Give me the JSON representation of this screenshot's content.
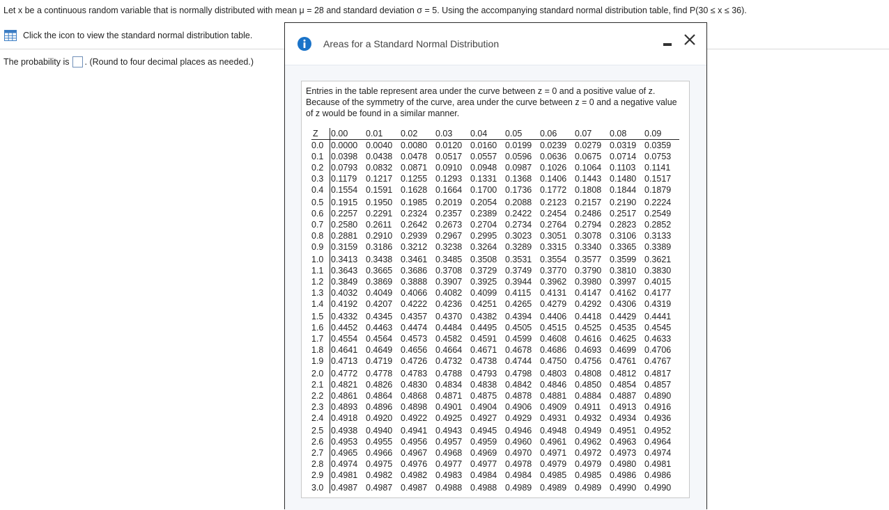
{
  "question": {
    "text": "Let x be a continuous random variable that is normally distributed with mean μ = 28 and standard deviation σ = 5. Using the accompanying standard normal distribution table, find P(30 ≤ x ≤ 36)."
  },
  "hint": {
    "icon": "table-icon",
    "text": "Click the icon to view the standard normal distribution table."
  },
  "answer": {
    "prefix": "The probability is",
    "value": "",
    "suffix": ". (Round to four decimal places as needed.)"
  },
  "dialog": {
    "title": "Areas for a Standard Normal Distribution",
    "description": "Entries in the table represent area under the curve between z = 0 and a positive value of z. Because of the symmetry of the curve, area under the curve between z = 0 and a negative value of z would be found in a similar manner.",
    "accent_color": "#1a73c8"
  },
  "table": {
    "z_header": "Z",
    "columns": [
      "0.00",
      "0.01",
      "0.02",
      "0.03",
      "0.04",
      "0.05",
      "0.06",
      "0.07",
      "0.08",
      "0.09"
    ],
    "rows": [
      {
        "z": "0.0",
        "v": [
          "0.0000",
          "0.0040",
          "0.0080",
          "0.0120",
          "0.0160",
          "0.0199",
          "0.0239",
          "0.0279",
          "0.0319",
          "0.0359"
        ]
      },
      {
        "z": "0.1",
        "v": [
          "0.0398",
          "0.0438",
          "0.0478",
          "0.0517",
          "0.0557",
          "0.0596",
          "0.0636",
          "0.0675",
          "0.0714",
          "0.0753"
        ]
      },
      {
        "z": "0.2",
        "v": [
          "0.0793",
          "0.0832",
          "0.0871",
          "0.0910",
          "0.0948",
          "0.0987",
          "0.1026",
          "0.1064",
          "0.1103",
          "0.1141"
        ]
      },
      {
        "z": "0.3",
        "v": [
          "0.1179",
          "0.1217",
          "0.1255",
          "0.1293",
          "0.1331",
          "0.1368",
          "0.1406",
          "0.1443",
          "0.1480",
          "0.1517"
        ]
      },
      {
        "z": "0.4",
        "v": [
          "0.1554",
          "0.1591",
          "0.1628",
          "0.1664",
          "0.1700",
          "0.1736",
          "0.1772",
          "0.1808",
          "0.1844",
          "0.1879"
        ]
      },
      {
        "z": "0.5",
        "v": [
          "0.1915",
          "0.1950",
          "0.1985",
          "0.2019",
          "0.2054",
          "0.2088",
          "0.2123",
          "0.2157",
          "0.2190",
          "0.2224"
        ]
      },
      {
        "z": "0.6",
        "v": [
          "0.2257",
          "0.2291",
          "0.2324",
          "0.2357",
          "0.2389",
          "0.2422",
          "0.2454",
          "0.2486",
          "0.2517",
          "0.2549"
        ]
      },
      {
        "z": "0.7",
        "v": [
          "0.2580",
          "0.2611",
          "0.2642",
          "0.2673",
          "0.2704",
          "0.2734",
          "0.2764",
          "0.2794",
          "0.2823",
          "0.2852"
        ]
      },
      {
        "z": "0.8",
        "v": [
          "0.2881",
          "0.2910",
          "0.2939",
          "0.2967",
          "0.2995",
          "0.3023",
          "0.3051",
          "0.3078",
          "0.3106",
          "0.3133"
        ]
      },
      {
        "z": "0.9",
        "v": [
          "0.3159",
          "0.3186",
          "0.3212",
          "0.3238",
          "0.3264",
          "0.3289",
          "0.3315",
          "0.3340",
          "0.3365",
          "0.3389"
        ]
      },
      {
        "z": "1.0",
        "v": [
          "0.3413",
          "0.3438",
          "0.3461",
          "0.3485",
          "0.3508",
          "0.3531",
          "0.3554",
          "0.3577",
          "0.3599",
          "0.3621"
        ]
      },
      {
        "z": "1.1",
        "v": [
          "0.3643",
          "0.3665",
          "0.3686",
          "0.3708",
          "0.3729",
          "0.3749",
          "0.3770",
          "0.3790",
          "0.3810",
          "0.3830"
        ]
      },
      {
        "z": "1.2",
        "v": [
          "0.3849",
          "0.3869",
          "0.3888",
          "0.3907",
          "0.3925",
          "0.3944",
          "0.3962",
          "0.3980",
          "0.3997",
          "0.4015"
        ]
      },
      {
        "z": "1.3",
        "v": [
          "0.4032",
          "0.4049",
          "0.4066",
          "0.4082",
          "0.4099",
          "0.4115",
          "0.4131",
          "0.4147",
          "0.4162",
          "0.4177"
        ]
      },
      {
        "z": "1.4",
        "v": [
          "0.4192",
          "0.4207",
          "0.4222",
          "0.4236",
          "0.4251",
          "0.4265",
          "0.4279",
          "0.4292",
          "0.4306",
          "0.4319"
        ]
      },
      {
        "z": "1.5",
        "v": [
          "0.4332",
          "0.4345",
          "0.4357",
          "0.4370",
          "0.4382",
          "0.4394",
          "0.4406",
          "0.4418",
          "0.4429",
          "0.4441"
        ]
      },
      {
        "z": "1.6",
        "v": [
          "0.4452",
          "0.4463",
          "0.4474",
          "0.4484",
          "0.4495",
          "0.4505",
          "0.4515",
          "0.4525",
          "0.4535",
          "0.4545"
        ]
      },
      {
        "z": "1.7",
        "v": [
          "0.4554",
          "0.4564",
          "0.4573",
          "0.4582",
          "0.4591",
          "0.4599",
          "0.4608",
          "0.4616",
          "0.4625",
          "0.4633"
        ]
      },
      {
        "z": "1.8",
        "v": [
          "0.4641",
          "0.4649",
          "0.4656",
          "0.4664",
          "0.4671",
          "0.4678",
          "0.4686",
          "0.4693",
          "0.4699",
          "0.4706"
        ]
      },
      {
        "z": "1.9",
        "v": [
          "0.4713",
          "0.4719",
          "0.4726",
          "0.4732",
          "0.4738",
          "0.4744",
          "0.4750",
          "0.4756",
          "0.4761",
          "0.4767"
        ]
      },
      {
        "z": "2.0",
        "v": [
          "0.4772",
          "0.4778",
          "0.4783",
          "0.4788",
          "0.4793",
          "0.4798",
          "0.4803",
          "0.4808",
          "0.4812",
          "0.4817"
        ]
      },
      {
        "z": "2.1",
        "v": [
          "0.4821",
          "0.4826",
          "0.4830",
          "0.4834",
          "0.4838",
          "0.4842",
          "0.4846",
          "0.4850",
          "0.4854",
          "0.4857"
        ]
      },
      {
        "z": "2.2",
        "v": [
          "0.4861",
          "0.4864",
          "0.4868",
          "0.4871",
          "0.4875",
          "0.4878",
          "0.4881",
          "0.4884",
          "0.4887",
          "0.4890"
        ]
      },
      {
        "z": "2.3",
        "v": [
          "0.4893",
          "0.4896",
          "0.4898",
          "0.4901",
          "0.4904",
          "0.4906",
          "0.4909",
          "0.4911",
          "0.4913",
          "0.4916"
        ]
      },
      {
        "z": "2.4",
        "v": [
          "0.4918",
          "0.4920",
          "0.4922",
          "0.4925",
          "0.4927",
          "0.4929",
          "0.4931",
          "0.4932",
          "0.4934",
          "0.4936"
        ]
      },
      {
        "z": "2.5",
        "v": [
          "0.4938",
          "0.4940",
          "0.4941",
          "0.4943",
          "0.4945",
          "0.4946",
          "0.4948",
          "0.4949",
          "0.4951",
          "0.4952"
        ]
      },
      {
        "z": "2.6",
        "v": [
          "0.4953",
          "0.4955",
          "0.4956",
          "0.4957",
          "0.4959",
          "0.4960",
          "0.4961",
          "0.4962",
          "0.4963",
          "0.4964"
        ]
      },
      {
        "z": "2.7",
        "v": [
          "0.4965",
          "0.4966",
          "0.4967",
          "0.4968",
          "0.4969",
          "0.4970",
          "0.4971",
          "0.4972",
          "0.4973",
          "0.4974"
        ]
      },
      {
        "z": "2.8",
        "v": [
          "0.4974",
          "0.4975",
          "0.4976",
          "0.4977",
          "0.4977",
          "0.4978",
          "0.4979",
          "0.4979",
          "0.4980",
          "0.4981"
        ]
      },
      {
        "z": "2.9",
        "v": [
          "0.4981",
          "0.4982",
          "0.4982",
          "0.4983",
          "0.4984",
          "0.4984",
          "0.4985",
          "0.4985",
          "0.4986",
          "0.4986"
        ]
      },
      {
        "z": "3.0",
        "v": [
          "0.4987",
          "0.4987",
          "0.4987",
          "0.4988",
          "0.4988",
          "0.4989",
          "0.4989",
          "0.4989",
          "0.4990",
          "0.4990"
        ]
      }
    ]
  }
}
